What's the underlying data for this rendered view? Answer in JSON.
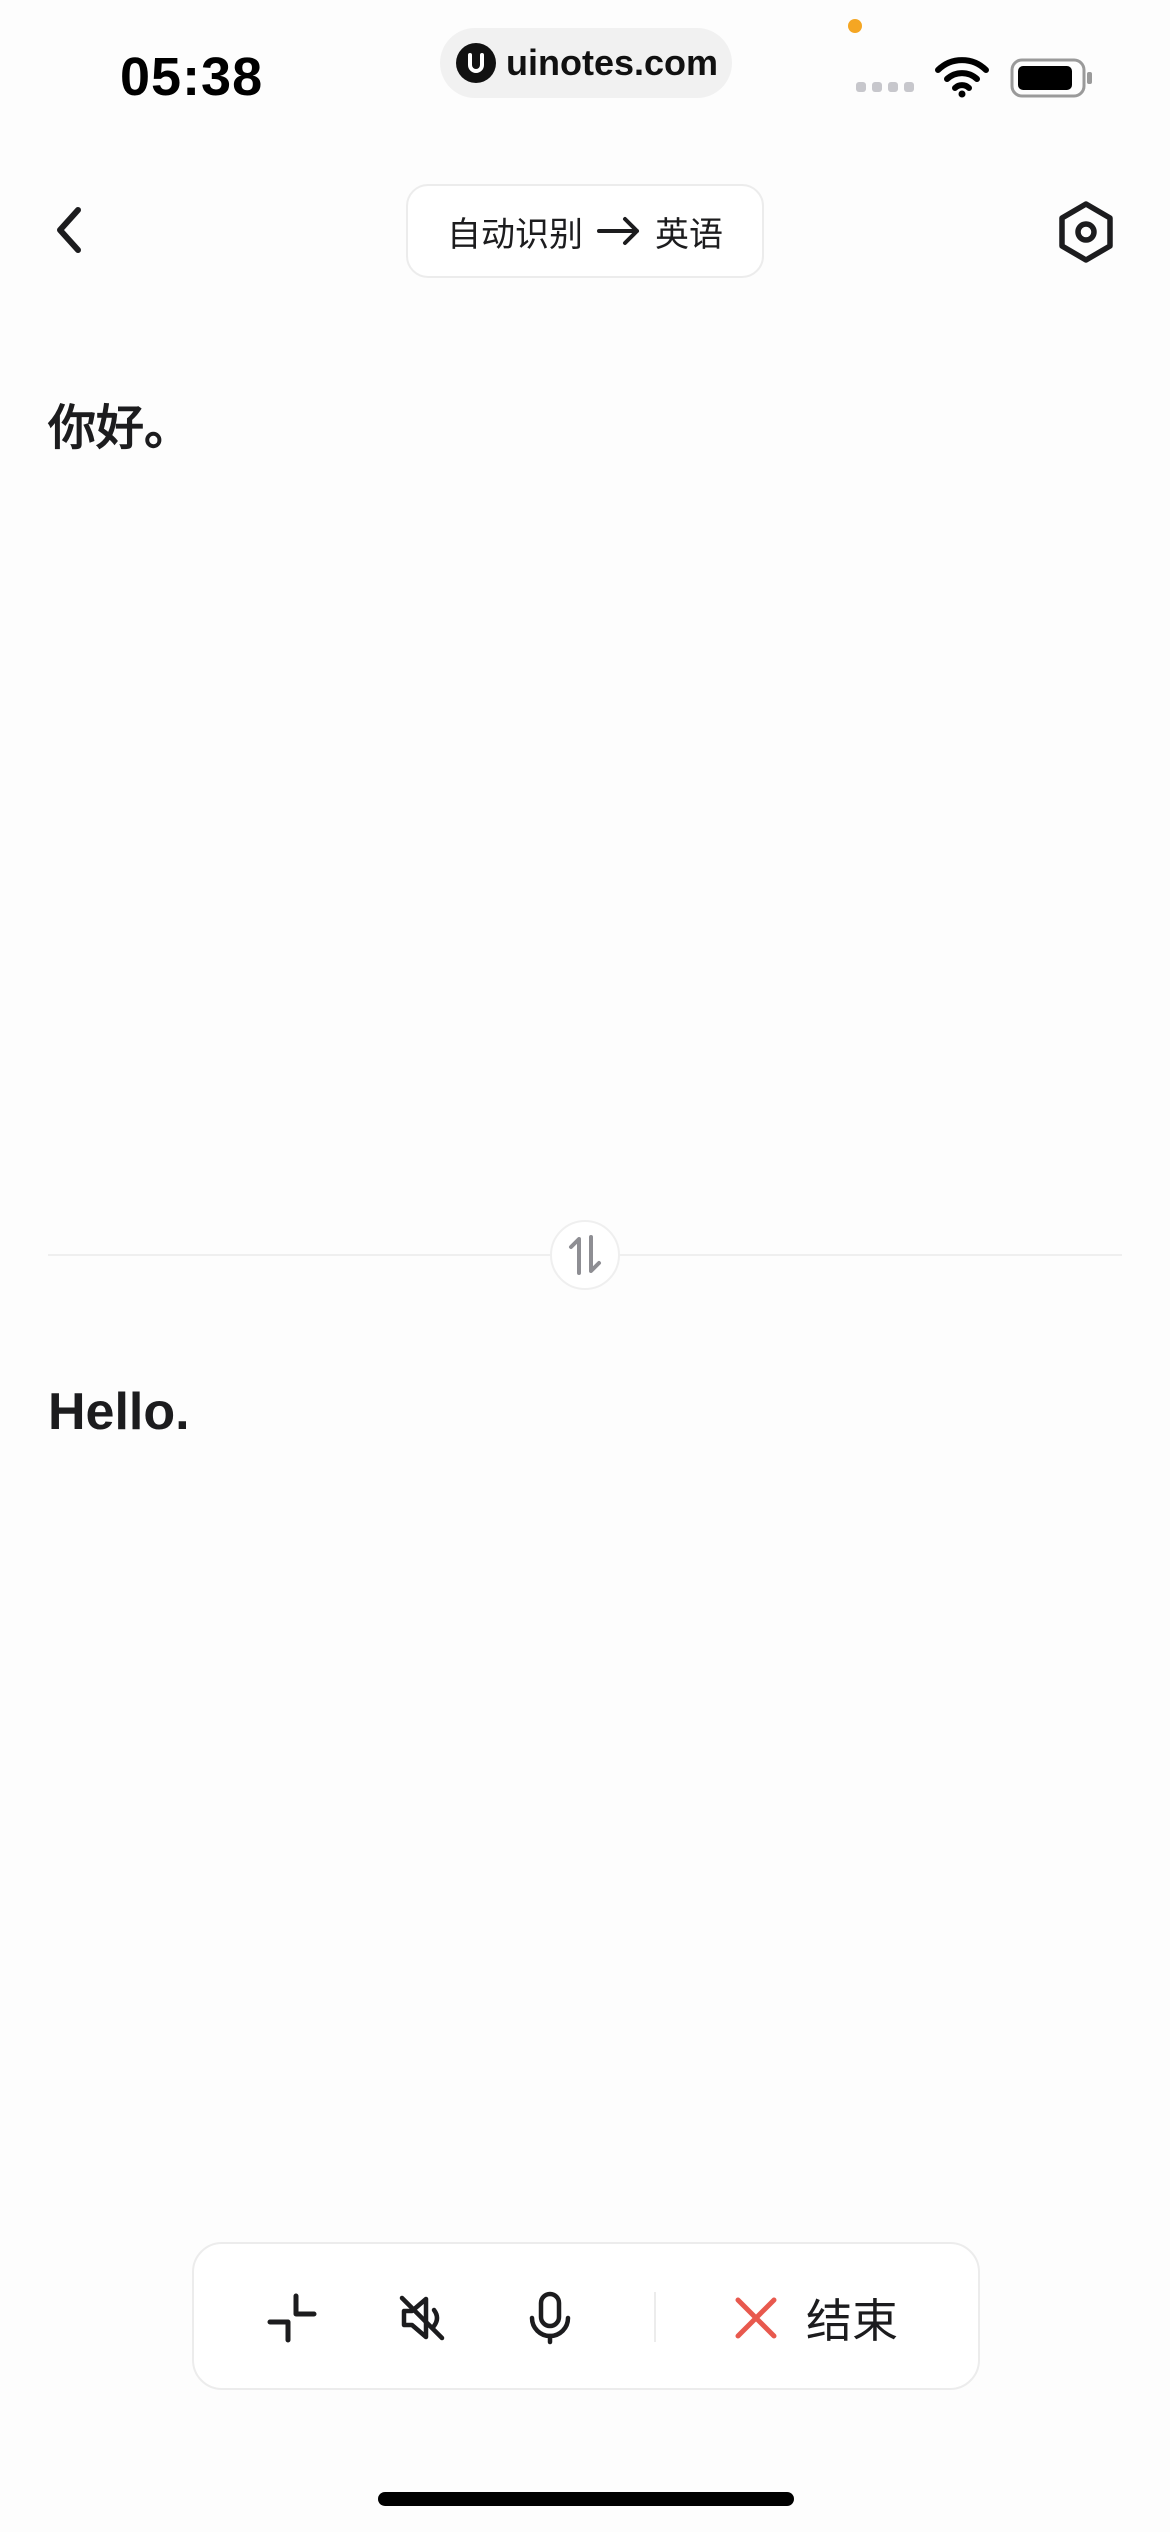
{
  "status_bar": {
    "time": "05:38",
    "url": "uinotes.com",
    "icons": [
      "signal-icon",
      "wifi-icon",
      "battery-icon"
    ]
  },
  "header": {
    "back_icon": "chevron-left-icon",
    "source_language": "自动识别",
    "target_language": "英语",
    "settings_icon": "hexagon-settings-icon"
  },
  "translation": {
    "source_text": "你好。",
    "target_text": "Hello.",
    "swap_icon": "swap-vertical-icon"
  },
  "toolbar": {
    "minimize_icon": "minimize-icon",
    "mute_icon": "speaker-muted-icon",
    "mic_icon": "microphone-icon",
    "end_label": "结束",
    "end_icon": "close-icon"
  },
  "colors": {
    "accent_red": "#e8594e",
    "text": "#1c1c1e",
    "border": "#ececec",
    "status_dot": "#f5a623"
  }
}
